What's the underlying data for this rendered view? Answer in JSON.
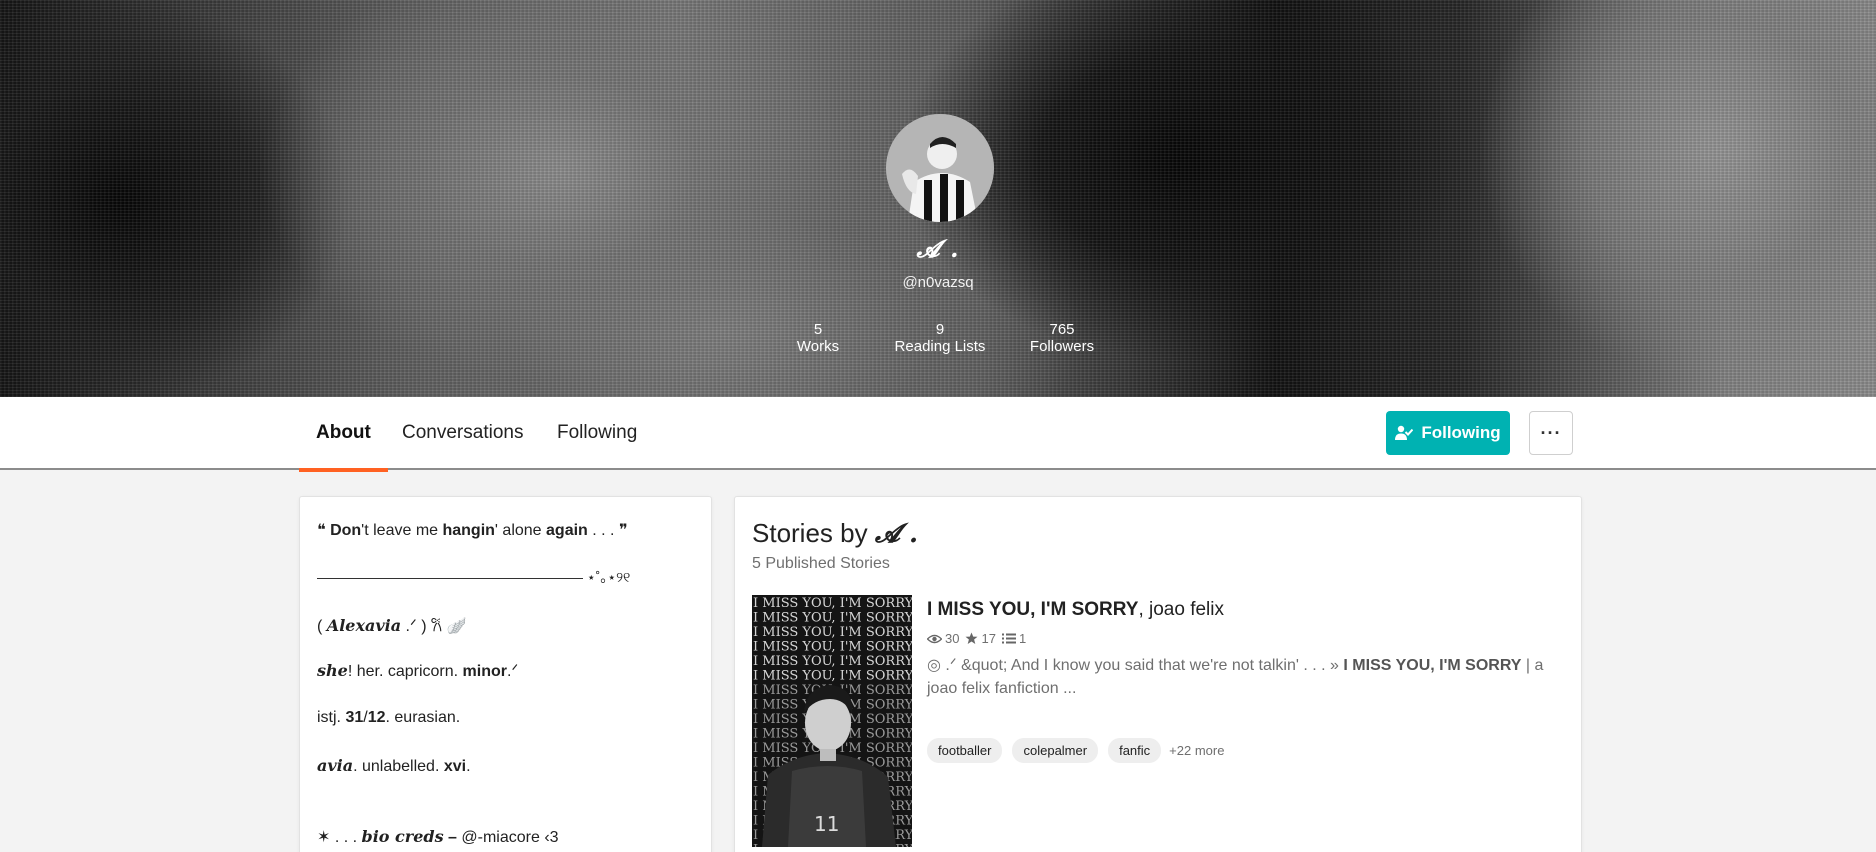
{
  "colors": {
    "accent": "#00b2b2",
    "active_tab": "#ff6122"
  },
  "profile": {
    "name": "𝓐 .",
    "handle": "@n0vazsq",
    "avatar_icon": "profile-avatar",
    "stats": {
      "works": {
        "num": "5",
        "label": "Works"
      },
      "lists": {
        "num": "9",
        "label": "Reading Lists"
      },
      "followers": {
        "num": "765",
        "label": "Followers"
      }
    }
  },
  "tabs": {
    "about": "About",
    "conversations": "Conversations",
    "following": "Following"
  },
  "actions": {
    "follow_label": "Following",
    "follow_icon": "user-check-icon",
    "more_label": "···",
    "more_icon": "more-icon"
  },
  "about": {
    "l1_open": "❝ ",
    "l1_a": "Don",
    "l1_b": "'t",
    "l1_c": "  leave me ",
    "l1_d": "hangin",
    "l1_e": "' alone ",
    "l1_f": "again",
    "l1_g": " . . . ",
    "l1_close": "❞",
    "l2": "——————————————————— ⋆˚｡⋆୨୧",
    "l3_a": "( ",
    "l3_b": "Alexavia",
    "l3_c": " .ᐟ ) ",
    "l3_d": "𐙚 🪽",
    "l4_a": "she",
    "l4_b": "! her.     capricorn.     ",
    "l4_c": "minor",
    "l4_d": ".ᐟ",
    "l5_a": "   istj.     ",
    "l5_b": "31",
    "l5_c": "/",
    "l5_d": "12",
    "l5_e": ".     eurasian.",
    "l6_a": "avia",
    "l6_b": ".     unlabelled.     ",
    "l6_c": "xvi",
    "l6_d": ".",
    "l7_a": "✶ . . . ",
    "l7_b": "bio creds",
    "l7_c": " – ",
    "l7_d": "@-miacore ‹3"
  },
  "stories": {
    "title_prefix": "Stories by ",
    "title_sig": "𝓐 .",
    "count": "5 Published Stories",
    "cover_text": "I MISS YOU, I'M SORRY",
    "cover_number": "11",
    "item": {
      "title_bold": "I MISS YOU, I'M SORRY",
      "title_rest": ", joao felix",
      "reads": "30",
      "votes": "17",
      "parts": "1",
      "desc_a": "◎ .ᐟ &quot; And I know you said that we're not talkin' . . . » ",
      "desc_b": "I MISS YOU, I'M SORRY",
      "desc_c": " | a joao felix fanfiction ...",
      "tags": [
        "footballer",
        "colepalmer",
        "fanfic"
      ],
      "tags_more": "+22 more"
    }
  }
}
